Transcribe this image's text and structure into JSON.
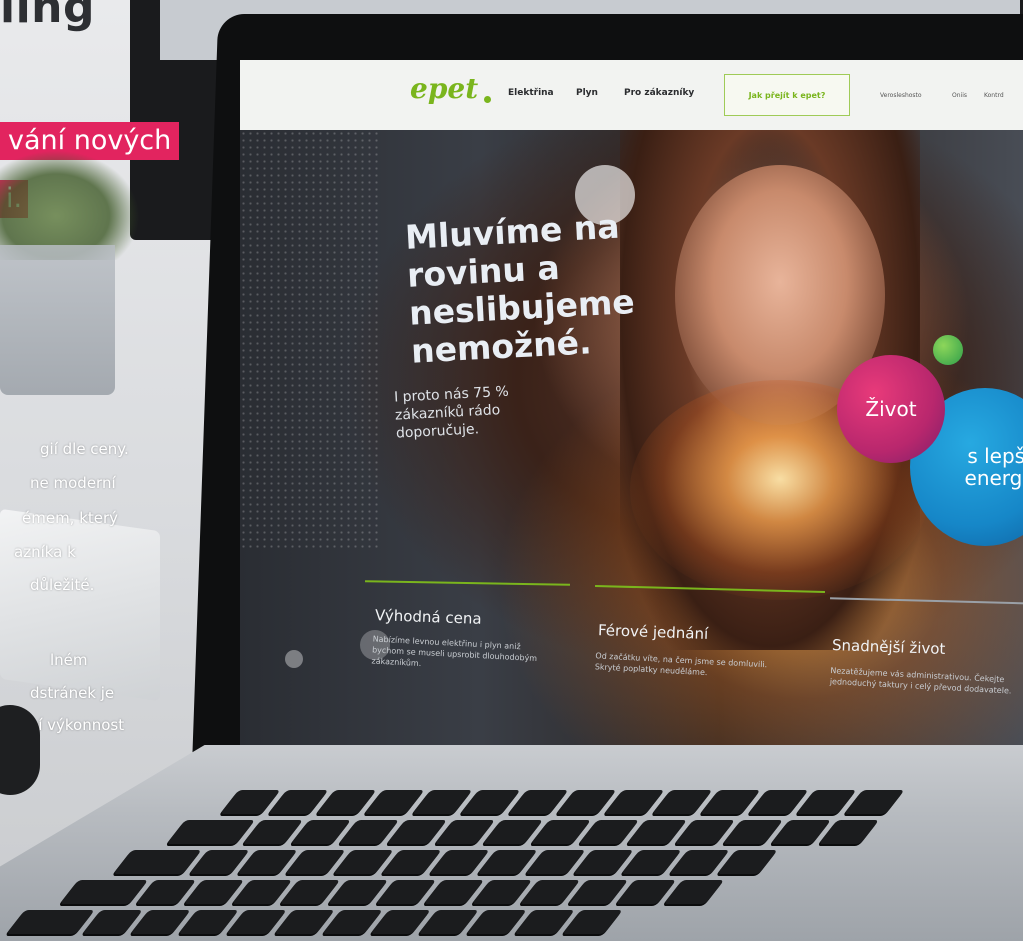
{
  "background_print": {
    "heading": "ling",
    "pink_line_1": "vání nových",
    "pink_line_2": "i.",
    "body_lines": [
      "gií dle ceny.",
      "ne moderní",
      "émem, který",
      "azníka k",
      "důležité.",
      "lném",
      "dstránek je",
      "odní výkonnost"
    ]
  },
  "site": {
    "logo": "epet",
    "nav": [
      "Elektřina",
      "Plyn",
      "Pro zákazníky"
    ],
    "cta": "Jak přejít k epet?",
    "nav_small": [
      "Verosleshosto",
      "Oniis",
      "Kontrd"
    ]
  },
  "hero": {
    "headline": "Mluvíme na rovinu a neslibujeme nemožné.",
    "subline": "I proto nás 75 % zákazníků rádo doporučuje.",
    "bubble_pink": "Život",
    "bubble_blue": "s lepší energií"
  },
  "features": [
    {
      "title": "Výhodná cena",
      "text": "Nabízíme levnou elektřinu i plyn aniž bychom se museli upsrobit dlouhodobým zákazníkům."
    },
    {
      "title": "Férové jednání",
      "text": "Od začátku víte, na čem jsme se domluvili. Skryté poplatky neuděláme."
    },
    {
      "title": "Snadnější život",
      "text": "Nezatěžujeme vás administrativou. Čekejte jednoduchý taktury i celý převod dodavatele."
    }
  ],
  "colors": {
    "brand_green": "#7ab51d",
    "accent_pink": "#e2245f",
    "bubble_pink": "#b8276d",
    "bubble_blue": "#1687c8"
  }
}
